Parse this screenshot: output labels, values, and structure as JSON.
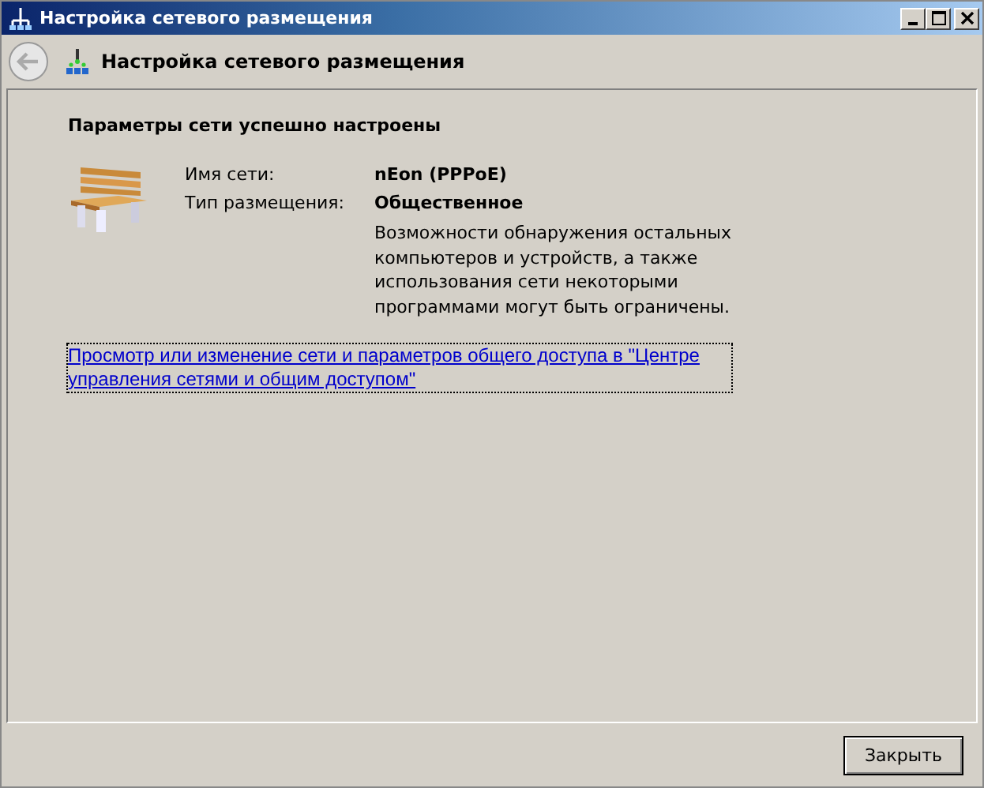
{
  "window": {
    "title": "Настройка сетевого размещения"
  },
  "header": {
    "title": "Настройка сетевого размещения"
  },
  "content": {
    "heading": "Параметры сети успешно настроены",
    "fields": [
      {
        "label": "Имя сети:",
        "value": "nEon (PPPoE)"
      },
      {
        "label": "Тип размещения:",
        "value": "Общественное"
      }
    ],
    "description": "Возможности обнаружения остальных компьютеров и устройств, а также использования сети некоторыми программами могут быть ограничены.",
    "link": "Просмотр или изменение сети и параметров общего доступа в \"Центре управления сетями и общим доступом\""
  },
  "buttons": [
    "Закрыть"
  ]
}
